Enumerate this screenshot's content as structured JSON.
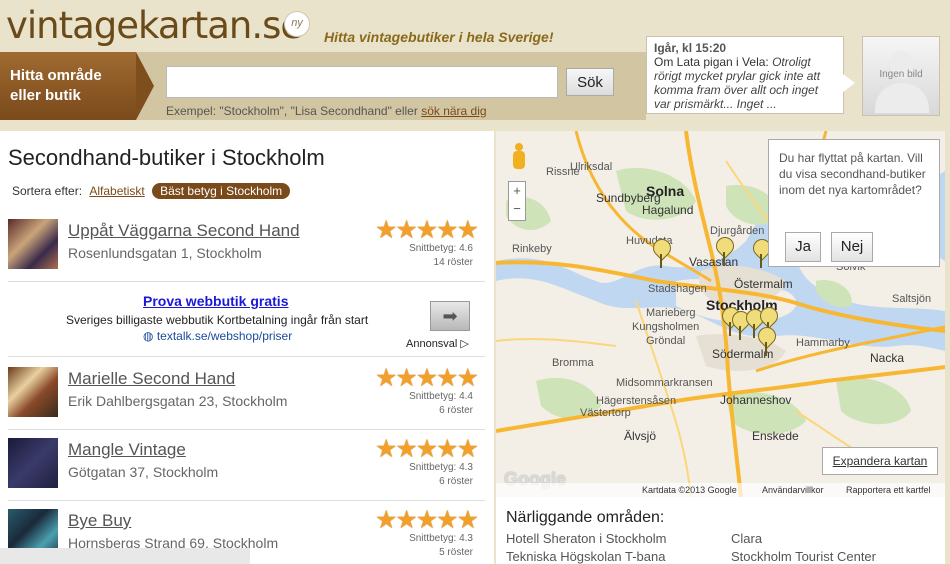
{
  "header": {
    "logo_text": "vintagekartan.se",
    "badge": "ny",
    "tagline": "Hitta vintagebutiker i hela Sverige!",
    "find_label": "Hitta område eller butik",
    "search_value": "",
    "search_button": "Sök",
    "example_text": "Exempel: \"Stockholm\", \"Lisa Secondhand\" eller",
    "example_link": "sök nära dig"
  },
  "comment": {
    "who": "Igår, kl 15:20",
    "intro": "Om Lata pigan i Vela: ",
    "quote": "Otroligt rörigt mycket prylar gick inte att komma fram över allt och inget var prismärkt... Inget ...",
    "avatar_label": "Ingen bild"
  },
  "list": {
    "title": "Secondhand-butiker i Stockholm",
    "sort_label": "Sortera efter:",
    "sort_alpha": "Alfabetiskt",
    "sort_active": "Bäst betyg i Stockholm",
    "shops": [
      {
        "name": "Uppåt Väggarna Second Hand",
        "address": "Rosenlundsgatan 1, Stockholm",
        "stars": "★★★★★",
        "rating": "Snittbetyg: 4.6",
        "votes": "14 röster"
      },
      {
        "name": "Marielle Second Hand",
        "address": "Erik Dahlbergsgatan 23, Stockholm",
        "stars": "★★★★★",
        "rating": "Snittbetyg: 4.4",
        "votes": "6 röster"
      },
      {
        "name": "Mangle Vintage",
        "address": "Götgatan 37, Stockholm",
        "stars": "★★★★★",
        "rating": "Snittbetyg: 4.3",
        "votes": "6 röster"
      },
      {
        "name": "Bye Buy",
        "address": "Hornsbergs Strand 69, Stockholm",
        "stars": "★★★★★",
        "rating": "Snittbetyg: 4.3",
        "votes": "5 röster"
      }
    ],
    "ad": {
      "title": "Prova webbutik gratis",
      "desc": "Sveriges billigaste webbutik Kortbetalning ingår från start",
      "url": "textalk.se/webshop/priser",
      "annons": "Annonsval ▷"
    }
  },
  "map": {
    "labels": {
      "solna": "Solna",
      "sundbyberg": "Sundbyberg",
      "ulriksdal": "Ulriksdal",
      "risne": "Rissne",
      "hagalund": "Hagalund",
      "huvudsta": "Huvudsta",
      "vasastan": "Vasastan",
      "ostermalm": "Östermalm",
      "stockholm": "Stockholm",
      "sodermalm": "Södermalm",
      "johanneshov": "Johanneshov",
      "enskede": "Enskede",
      "alvsjo": "Älvsjö",
      "nacka": "Nacka",
      "grondal": "Gröndal",
      "stadshagen": "Stadshagen",
      "marieberg": "Marieberg",
      "kungsholmen": "Kungsholmen",
      "rinkeby": "Rinkeby",
      "bromma": "Bromma",
      "hammarby": "Hammarby",
      "vastertorp": "Västertorp",
      "hagerstensasen": "Hägerstensåsen",
      "midsommarkransen": "Midsommarkransen",
      "djurgarden": "Djurgården",
      "solvik": "Solvik",
      "saltsjon": "Saltsjön"
    },
    "moved_text": "Du har flyttat på kartan. Vill du visa secondhand-butiker inom det nya kartområdet?",
    "yes": "Ja",
    "no": "Nej",
    "expand": "Expandera kartan",
    "footer_data": "Kartdata ©2013 Google",
    "footer_terms": "Användarvillkor",
    "footer_report": "Rapportera ett kartfel",
    "zoom_in": "+",
    "zoom_out": "−",
    "google_logo": "Google",
    "road_numbers": [
      "275",
      "275",
      "222",
      "222"
    ]
  },
  "nearby": {
    "heading": "Närliggande områden:",
    "items": [
      "Hotell Sheraton i Stockholm",
      "Tekniska Högskolan T-bana",
      "Clara",
      "Stockholm Tourist Center"
    ]
  },
  "colors": {
    "brand": "#7a4a1a",
    "accent": "#a06a32",
    "star": "#f2a02a",
    "link_ad": "#1a1ad6"
  }
}
